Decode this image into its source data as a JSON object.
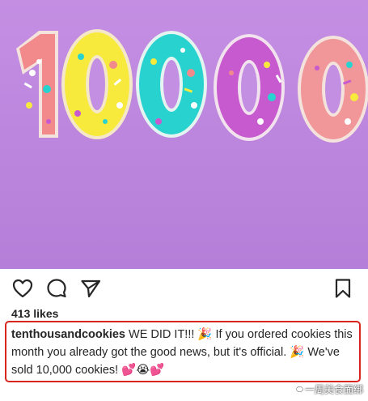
{
  "post": {
    "image": {
      "description_icon": "cookie-number-image",
      "digits": [
        "1",
        "0",
        "0",
        "0",
        "0"
      ],
      "digit_colors": [
        "#f28a8c",
        "#f7ea3d",
        "#28d3cf",
        "#c85ad0",
        "#f19699"
      ],
      "background_color": "#bd86de"
    },
    "actions": {
      "like_icon": "heart-icon",
      "comment_icon": "comment-icon",
      "share_icon": "share-icon",
      "save_icon": "bookmark-icon"
    },
    "likes_text": "413 likes",
    "caption": {
      "username": "tenthousandcookies",
      "text_part1": " WE DID IT!!! 🎉 If you ordered cookies this month you already got the good news, but it's official. 🎉 We've sold 10,000 cookies! 💕😭💕"
    },
    "accent_color": "#d7261e"
  },
  "watermark": {
    "text": "一周美食面绑"
  }
}
